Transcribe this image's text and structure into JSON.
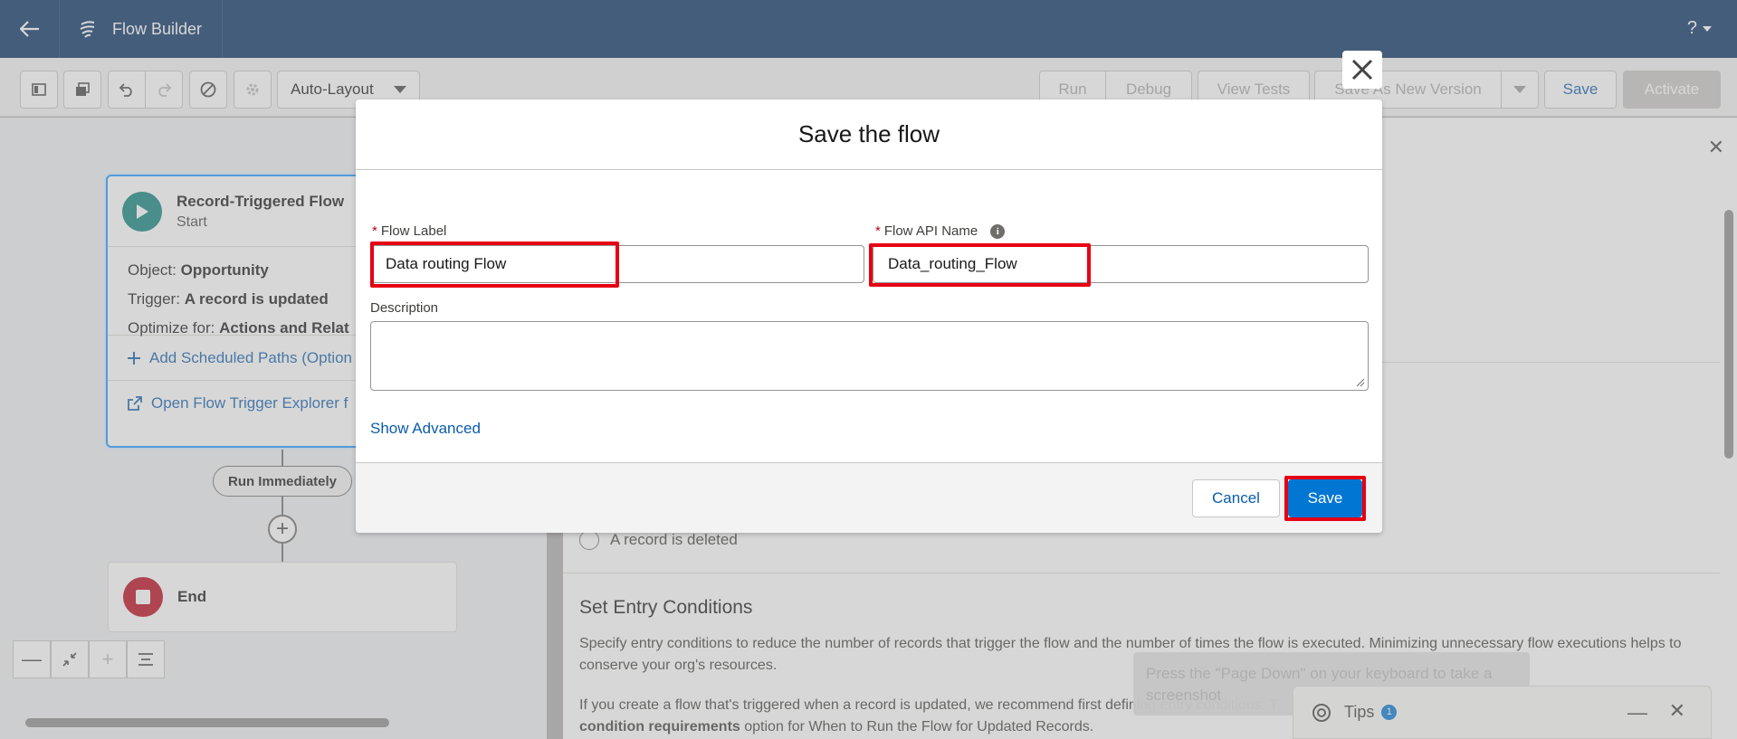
{
  "header": {
    "app_title": "Flow Builder",
    "help_label": "?"
  },
  "toolbar": {
    "layout_select": "Auto-Layout",
    "run_label": "Run",
    "debug_label": "Debug",
    "view_tests_label": "View Tests",
    "save_new_version_label": "Save As New Version",
    "save_label": "Save",
    "activate_label": "Activate"
  },
  "canvas": {
    "start_node": {
      "title": "Record-Triggered Flow",
      "subtitle": "Start",
      "object_label": "Object:",
      "object_value": "Opportunity",
      "trigger_label": "Trigger:",
      "trigger_value": "A record is updated",
      "optimize_label": "Optimize for:",
      "optimize_value": "Actions and Relat",
      "add_paths_link": "Add Scheduled Paths (Option",
      "explorer_link": "Open Flow Trigger Explorer f"
    },
    "run_immediately": "Run Immediately",
    "end_node": "End"
  },
  "panel": {
    "radio_option": "A record is deleted",
    "entry_title": "Set Entry Conditions",
    "entry_desc": "Specify entry conditions to reduce the number of records that trigger the flow and the number of times the flow is executed. Minimizing unnecessary flow executions helps to conserve your org's resources.",
    "entry_desc2": "If you create a flow that's triggered when a record is updated, we recommend first defining entry conditions. T",
    "entry_desc3_bold": "condition requirements",
    "entry_desc3_rest": " option for When to Run the Flow for Updated Records."
  },
  "hint_text": "Press the \"Page Down\" on your keyboard to take a screenshot",
  "tips": {
    "label": "Tips",
    "count": "1"
  },
  "modal": {
    "title": "Save the flow",
    "flow_label_label": "Flow Label",
    "flow_label_value": "Data routing Flow",
    "api_name_label": "Flow API Name",
    "api_name_value": "Data_routing_Flow",
    "description_label": "Description",
    "show_advanced": "Show Advanced",
    "cancel_label": "Cancel",
    "save_label": "Save",
    "required_mark": "*"
  },
  "colors": {
    "header_bg": "#032d60",
    "brand_blue": "#0176d3",
    "highlight_red": "#e60012"
  }
}
